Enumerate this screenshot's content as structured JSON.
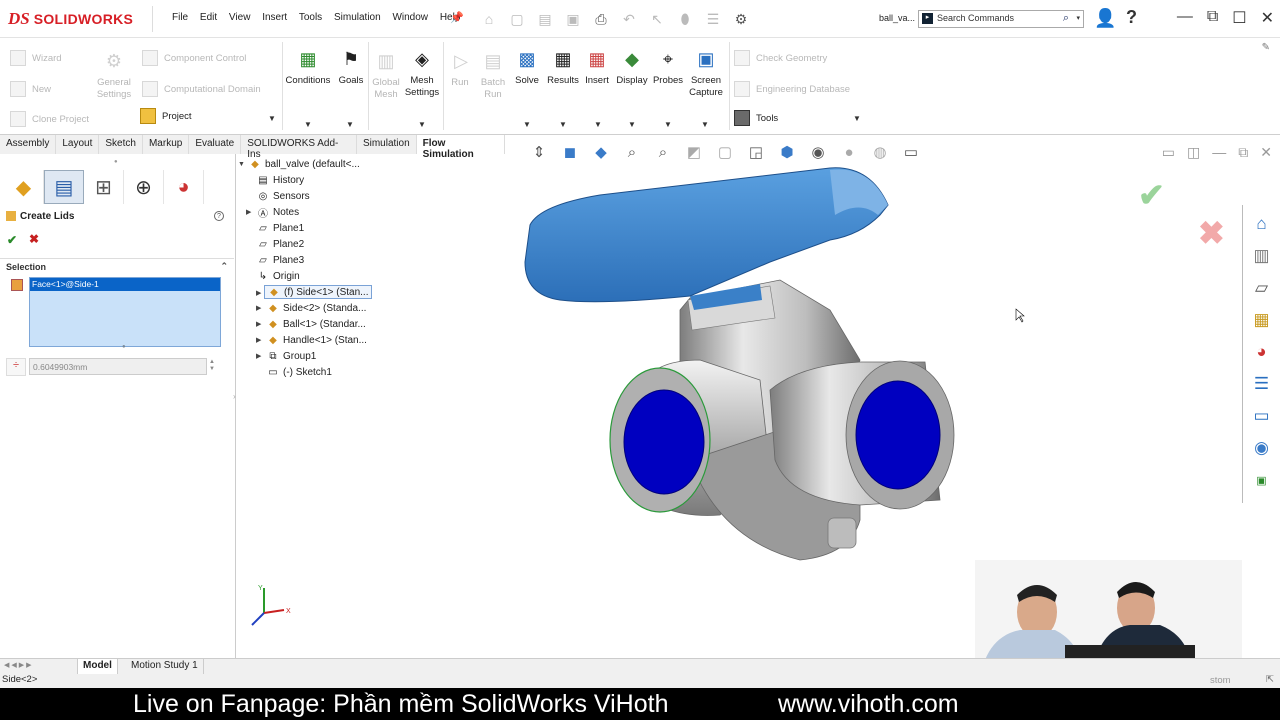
{
  "app": {
    "brand_ds": "DS",
    "brand_name": "SOLIDWORKS"
  },
  "menu": [
    "File",
    "Edit",
    "View",
    "Insert",
    "Tools",
    "Simulation",
    "Window",
    "Help"
  ],
  "doc_title": "ball_va...",
  "search": {
    "placeholder": "Search Commands"
  },
  "ribbon": {
    "left_small": [
      "Wizard",
      "New",
      "Clone Project"
    ],
    "general_settings": "General Settings",
    "component_control": "Component Control",
    "computational_domain": "Computational Domain",
    "project": "Project",
    "conditions": "Conditions",
    "goals": "Goals",
    "global_mesh": "Global Mesh",
    "mesh_settings": "Mesh Settings",
    "run": "Run",
    "batch_run": "Batch Run",
    "solve": "Solve",
    "results": "Results",
    "insert": "Insert",
    "display": "Display",
    "probes": "Probes",
    "screen_capture": "Screen Capture",
    "check_geometry": "Check Geometry",
    "engineering_database": "Engineering Database",
    "tools": "Tools"
  },
  "tabs": [
    "Assembly",
    "Layout",
    "Sketch",
    "Markup",
    "Evaluate",
    "SOLIDWORKS Add-Ins",
    "Simulation",
    "Flow Simulation"
  ],
  "active_tab": "Flow Simulation",
  "property_manager": {
    "title": "Create Lids",
    "help": "?",
    "ok": "✔",
    "cancel": "✖",
    "selection_header": "Selection",
    "selected_face": "Face<1>@Side-1",
    "thickness": "0.6049903mm"
  },
  "tree": {
    "root": "ball_valve  (default<...",
    "items": [
      {
        "label": "History"
      },
      {
        "label": "Sensors"
      },
      {
        "label": "Notes"
      },
      {
        "label": "Plane1"
      },
      {
        "label": "Plane2"
      },
      {
        "label": "Plane3"
      },
      {
        "label": "Origin"
      },
      {
        "label": "(f) Side<1> (Stan..."
      },
      {
        "label": "Side<2> (Standa..."
      },
      {
        "label": "Ball<1> (Standar..."
      },
      {
        "label": "Handle<1> (Stan..."
      },
      {
        "label": "Group1"
      },
      {
        "label": "(-) Sketch1"
      }
    ]
  },
  "bottom_tabs": [
    "Model",
    "Motion Study 1"
  ],
  "status_text": "Side<2>",
  "status_right": "stom",
  "banner": {
    "left": "Live on Fanpage: Phần mềm SolidWorks ViHoth",
    "right": "www.vihoth.com"
  },
  "triad": {
    "x": "X",
    "y": "Y"
  },
  "colors": {
    "brand": "#d71f26",
    "handle": "#3b82c8",
    "lid": "#0000c0",
    "body": "#c8c8c8"
  }
}
